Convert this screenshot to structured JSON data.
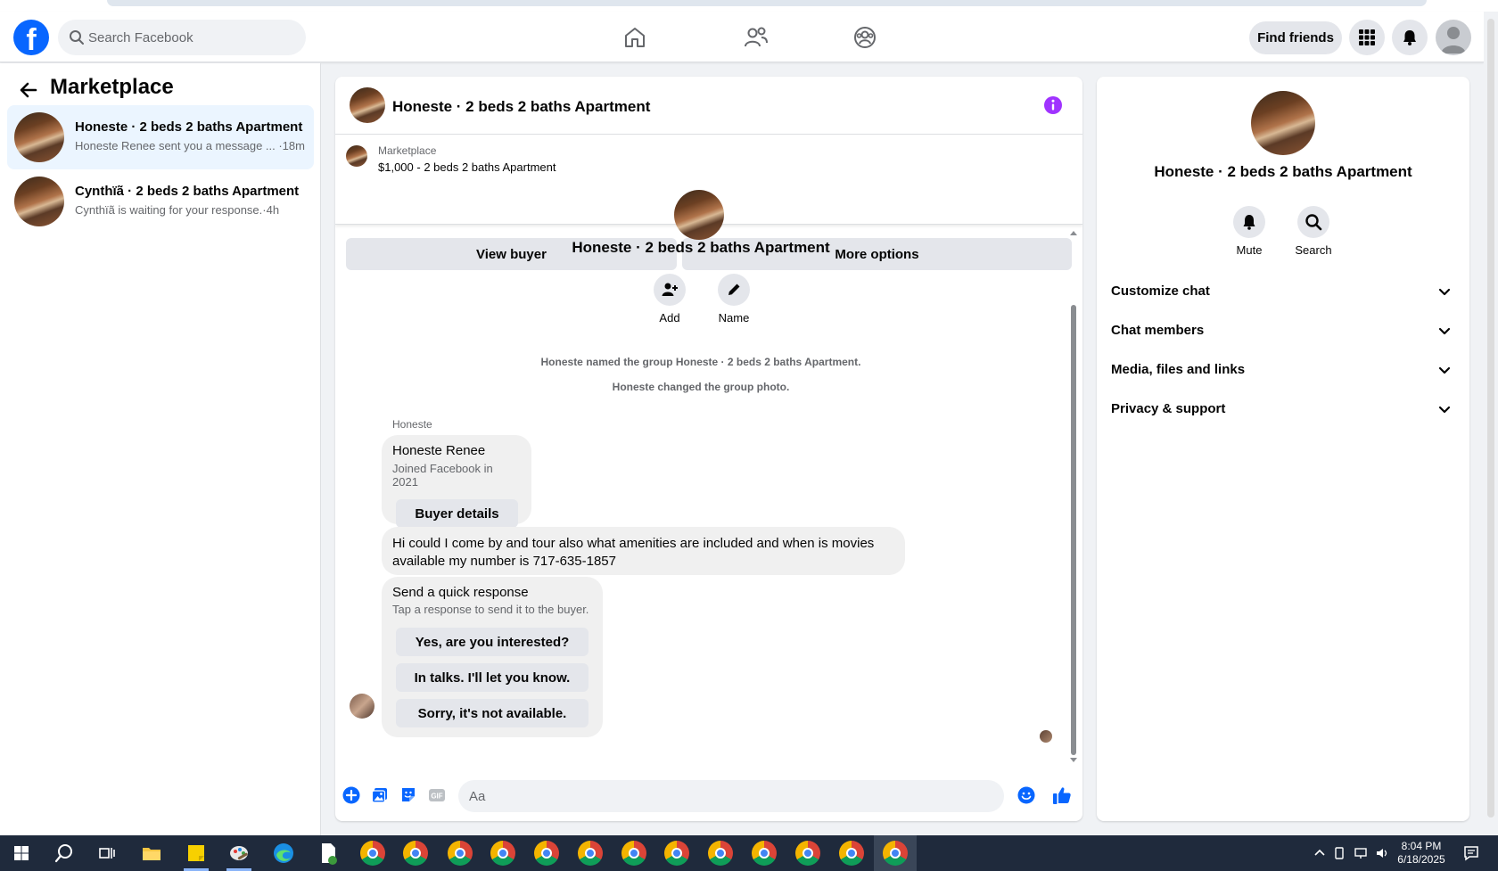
{
  "header": {
    "search_placeholder": "Search Facebook",
    "find_friends_label": "Find friends"
  },
  "sidebar": {
    "title": "Marketplace",
    "conversations": [
      {
        "title": "Honeste · 2 beds 2 baths Apartment",
        "preview": "Honeste Renee sent you a message ... ·18m",
        "active": true
      },
      {
        "title": "Cynthïã · 2 beds 2 baths Apartment",
        "preview": "Cynthïã is waiting for your response.·4h",
        "active": false
      }
    ]
  },
  "chat": {
    "title": "Honeste · 2 beds 2 baths Apartment",
    "listing_source": "Marketplace",
    "listing_price_title": "$1,000 - 2 beds 2 baths Apartment",
    "view_buyer_label": "View buyer",
    "more_options_label": "More options",
    "group_name": "Honeste · 2 beds 2 baths Apartment",
    "actions": [
      {
        "label": "Add",
        "icon": "add-person-icon"
      },
      {
        "label": "Name",
        "icon": "pencil-icon"
      }
    ],
    "system_messages": [
      "Honeste named the group Honeste · 2 beds 2 baths Apartment.",
      "Honeste changed the group photo."
    ],
    "sender_name": "Honeste",
    "buyer_card": {
      "name": "Honeste Renee",
      "joined": "Joined Facebook in 2021",
      "button_label": "Buyer details"
    },
    "message_text": "Hi could I come by and tour also what amenities are included and when is movies available my number is 717-635-1857",
    "quick_response": {
      "title": "Send a quick response",
      "subtitle": "Tap a response to send it to the buyer.",
      "options": [
        "Yes, are you interested?",
        "In talks. I'll let you know.",
        "Sorry, it's not available."
      ]
    },
    "composer_placeholder": "Aa"
  },
  "right_panel": {
    "title": "Honeste · 2 beds 2 baths Apartment",
    "actions": [
      {
        "label": "Mute",
        "icon": "bell-icon"
      },
      {
        "label": "Search",
        "icon": "search-icon"
      }
    ],
    "sections": [
      "Customize chat",
      "Chat members",
      "Media, files and links",
      "Privacy & support"
    ]
  },
  "taskbar": {
    "time": "8:04 PM",
    "date": "6/18/2025"
  },
  "colors": {
    "facebook_blue": "#0866ff",
    "info_purple": "#a033ff",
    "active_conversation_bg": "#ebf5ff"
  }
}
